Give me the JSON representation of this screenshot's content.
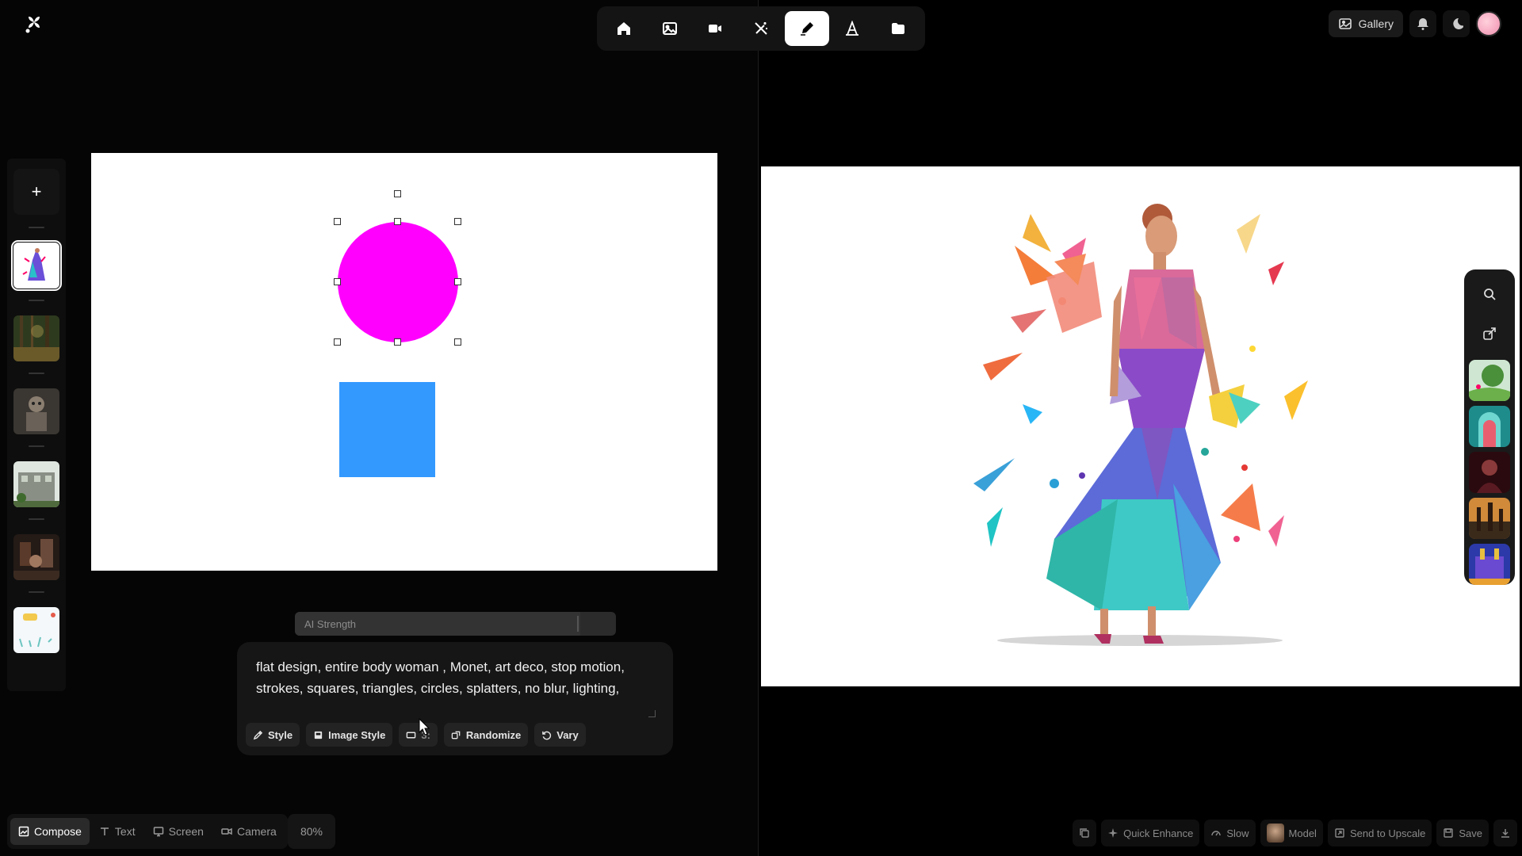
{
  "app": {
    "logo_icon": "app-logo-icon"
  },
  "top_toolbar": {
    "tools": [
      {
        "name": "home",
        "icon": "home-icon"
      },
      {
        "name": "image",
        "icon": "image-icon"
      },
      {
        "name": "video",
        "icon": "video-camera-icon"
      },
      {
        "name": "magic",
        "icon": "magic-wand-icon"
      },
      {
        "name": "draw",
        "icon": "pen-icon",
        "active": true
      },
      {
        "name": "text",
        "icon": "text-a-icon"
      },
      {
        "name": "folder",
        "icon": "folder-icon"
      }
    ]
  },
  "header_right": {
    "gallery_label": "Gallery",
    "bell_icon": "bell-icon",
    "theme_icon": "moon-icon"
  },
  "thumb_rail": {
    "add_label": "+",
    "thumbs": [
      "woman-art",
      "forest",
      "robot",
      "building",
      "interior",
      "abstract-light"
    ],
    "selected_index": 0
  },
  "canvas": {
    "shapes": [
      {
        "type": "circle",
        "color": "#ff00ff",
        "selected": true
      },
      {
        "type": "square",
        "color": "#3399ff",
        "selected": false
      }
    ]
  },
  "ai_strength": {
    "label": "AI Strength",
    "level": 0.89
  },
  "prompt": {
    "text": "flat design, entire body woman , Monet, art deco, stop motion, strokes, squares, triangles, circles, splatters, no blur, lighting,",
    "chips": [
      {
        "label": "Style",
        "icon": "style-icon"
      },
      {
        "label": "Image Style",
        "icon": "image-style-icon"
      },
      {
        "label": "3:",
        "icon": "aspect-ratio-icon"
      },
      {
        "label": "Randomize",
        "icon": "dice-icon"
      },
      {
        "label": "Vary",
        "icon": "refresh-icon"
      }
    ]
  },
  "bottom_modes": {
    "items": [
      {
        "label": "Compose",
        "active": true
      },
      {
        "label": "Text",
        "active": false
      },
      {
        "label": "Screen",
        "active": false
      },
      {
        "label": "Camera",
        "active": false
      }
    ],
    "zoom_label": "80%"
  },
  "result_actions": {
    "copy_icon": "copy-icon",
    "quick_enhance_label": "Quick Enhance",
    "slow_label": "Slow",
    "model_label": "Model",
    "send_to_upscale_label": "Send to Upscale",
    "save_label": "Save",
    "download_icon": "download-icon"
  },
  "side_tools": {
    "search_icon": "search-icon",
    "share_icon": "share-icon",
    "history_thumbs": [
      "garden",
      "teal-arch",
      "dark-portrait",
      "sunset-towers",
      "palace"
    ]
  }
}
